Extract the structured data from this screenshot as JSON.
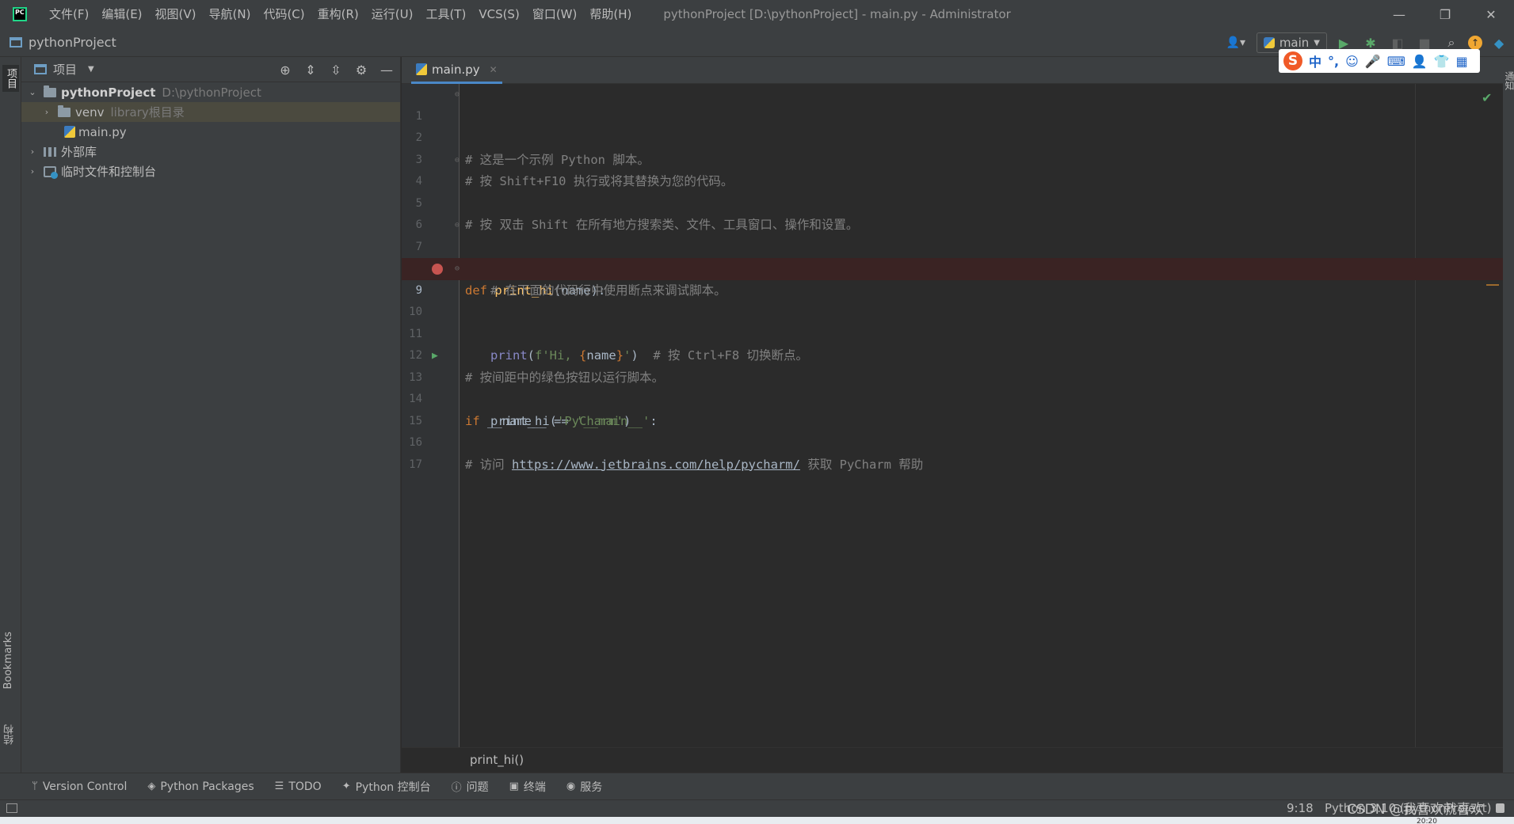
{
  "titlebar": {
    "menu": [
      "文件(F)",
      "编辑(E)",
      "视图(V)",
      "导航(N)",
      "代码(C)",
      "重构(R)",
      "运行(U)",
      "工具(T)",
      "VCS(S)",
      "窗口(W)",
      "帮助(H)"
    ],
    "window_title": "pythonProject [D:\\pythonProject] - main.py - Administrator"
  },
  "navbar": {
    "project_name": "pythonProject",
    "run_config": "main"
  },
  "ime": {
    "logo": "S",
    "items": [
      "中",
      "°,",
      "☺",
      "🎤",
      "⌨",
      "👤",
      "👕",
      "▦"
    ]
  },
  "left_strip": {
    "project_tab": "项目",
    "bookmarks_tab": "Bookmarks",
    "structure_tab": "结构"
  },
  "right_strip": {
    "notifications_tab": "通知"
  },
  "project_panel": {
    "title": "项目",
    "tree": {
      "root_name": "pythonProject",
      "root_path": "D:\\pythonProject",
      "venv_name": "venv",
      "venv_note": "library根目录",
      "main_file": "main.py",
      "external_libs": "外部库",
      "scratches": "临时文件和控制台"
    }
  },
  "editor": {
    "tab_label": "main.py",
    "line_numbers": [
      "1",
      "2",
      "3",
      "4",
      "5",
      "6",
      "7",
      "8",
      "9",
      "10",
      "11",
      "12",
      "13",
      "14",
      "15",
      "16",
      "17"
    ],
    "breakpoint_line": 9,
    "lines": {
      "l1": "# 这是一个示例 Python 脚本。",
      "l3": "# 按 Shift+F10 执行或将其替换为您的代码。",
      "l4": "# 按 双击 Shift 在所有地方搜索类、文件、工具窗口、操作和设置。",
      "l7_kw": "def",
      "l7_fn": "print_hi",
      "l7_rest": "(name):",
      "l8": "# 在下面的代码行中使用断点来调试脚本。",
      "l9_builtin": "print",
      "l9_open": "(",
      "l9_str1": "f'Hi, ",
      "l9_brace1": "{",
      "l9_var": "name",
      "l9_brace2": "}",
      "l9_str2": "'",
      "l9_close": ")",
      "l9_comment": "# 按 Ctrl+F8 切换断点。",
      "l12": "# 按间距中的绿色按钮以运行脚本。",
      "l13_kw": "if",
      "l13_mid": "__name__ ==",
      "l13_str": "'__main__'",
      "l13_colon": ":",
      "l14_fn": "print_hi(",
      "l14_str": "'PyCharm'",
      "l14_close": ")",
      "l16_prefix": "# 访问",
      "l16_link": "https://www.jetbrains.com/help/pycharm/",
      "l16_suffix": "获取 PyCharm 帮助"
    },
    "breadcrumb": "print_hi()"
  },
  "bottom_tools": [
    "Version Control",
    "Python Packages",
    "TODO",
    "Python 控制台",
    "问题",
    "终端",
    "服务"
  ],
  "statusbar": {
    "caret": "9:18",
    "interpreter": "Python 3.10 (pythonProject)",
    "watermark": "CSDN @我喜欢就喜欢"
  },
  "taskbar": {
    "clock": "20:20"
  },
  "colors": {
    "accent": "#4a88c7",
    "run_green": "#59a869",
    "breakpoint_red": "#c75450",
    "keyword": "#cc7832",
    "function": "#ffc66d",
    "string": "#6a8759",
    "comment": "#808080"
  }
}
